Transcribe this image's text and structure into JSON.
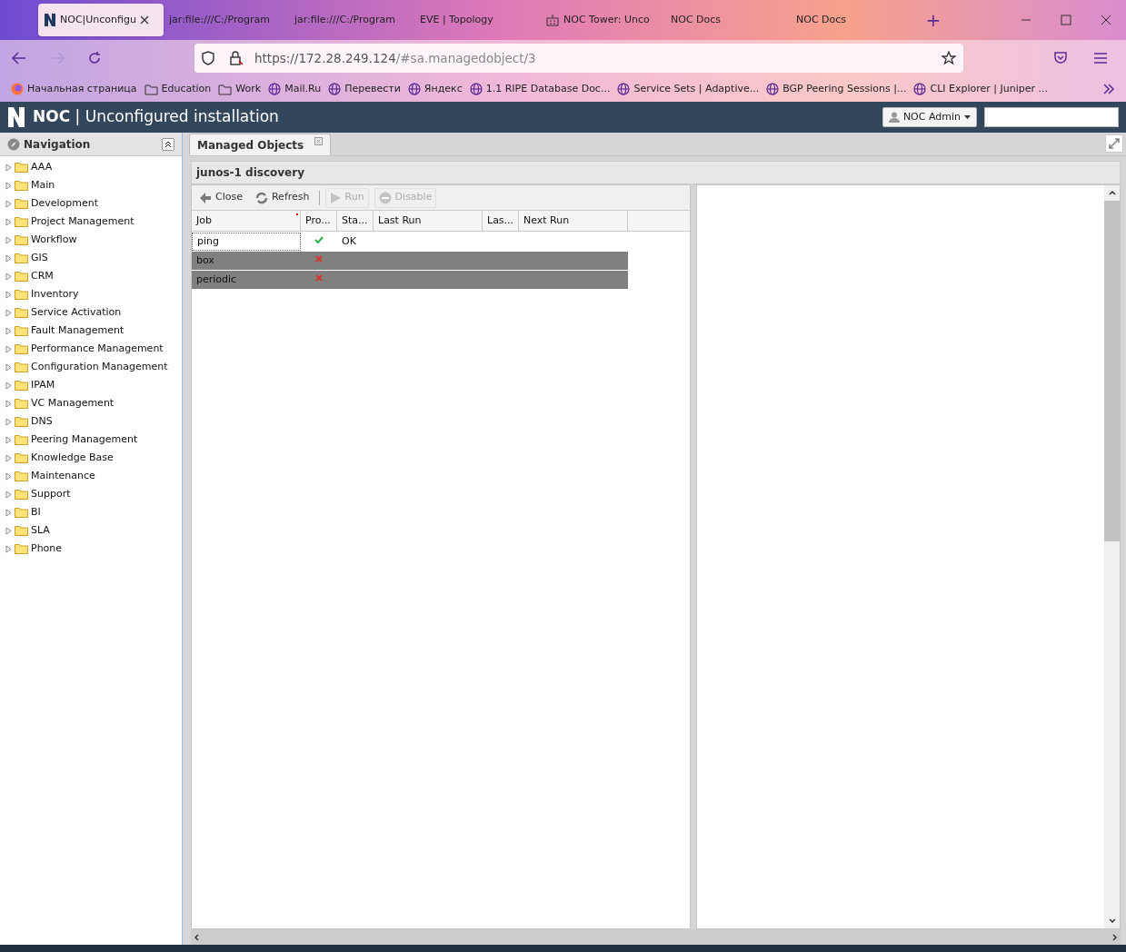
{
  "browser_tabs": [
    {
      "title": "NOC|Unconfigu",
      "selected": true
    },
    {
      "title": "jar:file:///C:/Program",
      "selected": false
    },
    {
      "title": "jar:file:///C:/Program",
      "selected": false
    },
    {
      "title": "EVE | Topology",
      "selected": false
    },
    {
      "title": "NOC Tower: Unco",
      "selected": false
    },
    {
      "title": "NOC Docs",
      "selected": false
    },
    {
      "title": "NOC Docs",
      "selected": false
    }
  ],
  "new_tab": "+",
  "address": {
    "host": "https://172.28.249.124",
    "path": "/#sa.managedobject/3"
  },
  "bookmarks": [
    {
      "label": "Начальная страница",
      "kind": "browser"
    },
    {
      "label": "Education",
      "kind": "folder"
    },
    {
      "label": "Work",
      "kind": "folder"
    },
    {
      "label": "Mail.Ru",
      "kind": "globe"
    },
    {
      "label": "Перевести",
      "kind": "globe"
    },
    {
      "label": "Яндекс",
      "kind": "globe"
    },
    {
      "label": "1.1 RIPE Database Doc...",
      "kind": "globe"
    },
    {
      "label": "Service Sets | Adaptive...",
      "kind": "globe"
    },
    {
      "label": "BGP Peering Sessions |...",
      "kind": "globe"
    },
    {
      "label": "CLI Explorer | Juniper ...",
      "kind": "globe"
    }
  ],
  "app": {
    "brand": "NOC",
    "separator": "|",
    "title": "Unconfigured installation",
    "user": "NOC Admin"
  },
  "navigation": {
    "title": "Navigation",
    "items": [
      {
        "label": "AAA",
        "expanded": false
      },
      {
        "label": "Main",
        "expanded": false
      },
      {
        "label": "Development",
        "expanded": false
      },
      {
        "label": "Project Management",
        "expanded": false
      },
      {
        "label": "Workflow",
        "expanded": false
      },
      {
        "label": "GIS",
        "expanded": false
      },
      {
        "label": "CRM",
        "expanded": false
      },
      {
        "label": "Inventory",
        "expanded": false
      },
      {
        "label": "Service Activation",
        "expanded": false
      },
      {
        "label": "Fault Management",
        "expanded": false
      },
      {
        "label": "Performance Management",
        "expanded": false
      },
      {
        "label": "Configuration Management",
        "expanded": false
      },
      {
        "label": "IPAM",
        "expanded": false
      },
      {
        "label": "VC Management",
        "expanded": false
      },
      {
        "label": "DNS",
        "expanded": false
      },
      {
        "label": "Peering Management",
        "expanded": false
      },
      {
        "label": "Knowledge Base",
        "expanded": false
      },
      {
        "label": "Maintenance",
        "expanded": false
      },
      {
        "label": "Support",
        "expanded": false
      },
      {
        "label": "BI",
        "expanded": false
      },
      {
        "label": "SLA",
        "expanded": false
      },
      {
        "label": "Phone",
        "expanded": false
      }
    ]
  },
  "app_tabs": [
    {
      "label": "Managed Objects",
      "selected": true
    }
  ],
  "panel_title": "junos-1 discovery",
  "toolbar": [
    {
      "label": "Close",
      "kind": "close",
      "disabled": false
    },
    {
      "label": "Refresh",
      "kind": "refresh",
      "disabled": false
    },
    {
      "label": "Run",
      "kind": "run",
      "disabled": true
    },
    {
      "label": "Disable",
      "kind": "disable",
      "disabled": true
    }
  ],
  "table": {
    "columns": [
      "Job",
      "Pro...",
      "Sta...",
      "Last Run",
      "Las...",
      "Next Run"
    ],
    "rows": [
      {
        "job": "ping",
        "provisioned": true,
        "status": "OK",
        "disabled": false,
        "focused": true
      },
      {
        "job": "box",
        "provisioned": false,
        "disabled": true,
        "focused": false
      },
      {
        "job": "periodic",
        "provisioned": false,
        "disabled": true,
        "focused": false
      }
    ]
  }
}
